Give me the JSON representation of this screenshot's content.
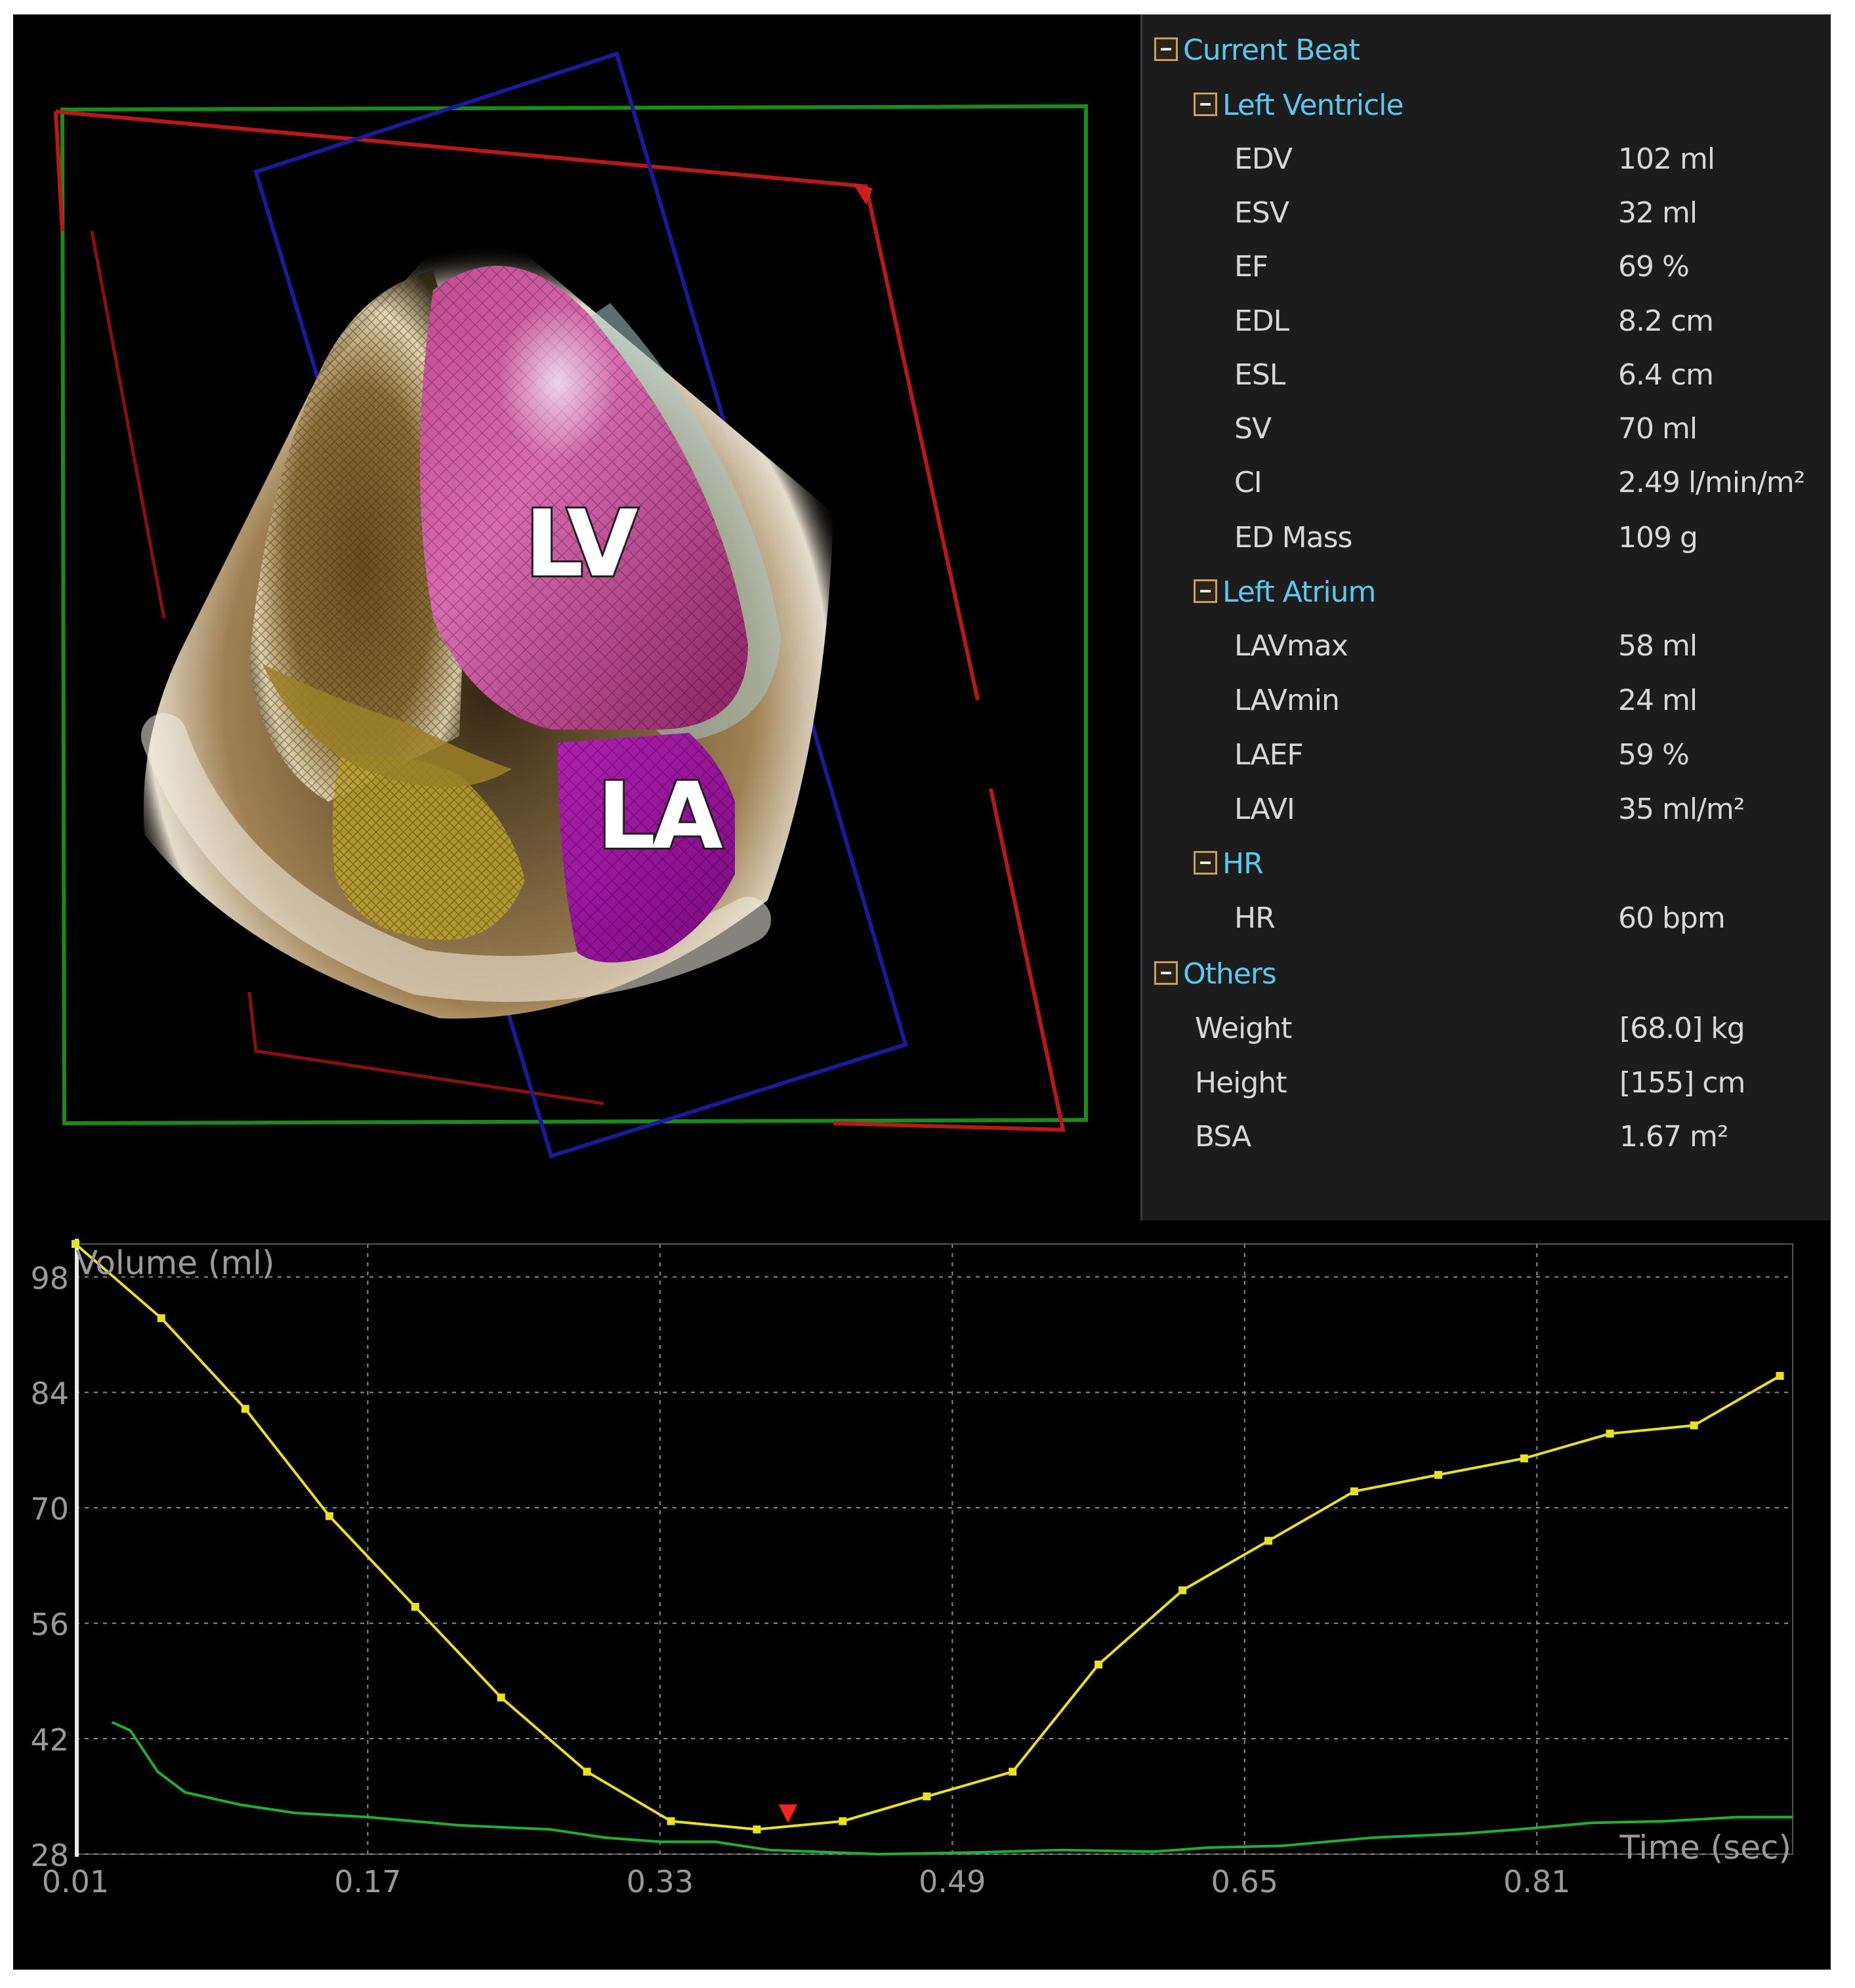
{
  "viewport": {
    "labels": {
      "lv": "LV",
      "la": "LA"
    }
  },
  "panel": {
    "sections": [
      {
        "title": "Current Beat",
        "groups": [
          {
            "title": "Left Ventricle",
            "rows": [
              {
                "label": "EDV",
                "value": "102 ml"
              },
              {
                "label": "ESV",
                "value": "32 ml"
              },
              {
                "label": "EF",
                "value": "69 %"
              },
              {
                "label": "EDL",
                "value": "8.2 cm"
              },
              {
                "label": "ESL",
                "value": "6.4 cm"
              },
              {
                "label": "SV",
                "value": "70 ml"
              },
              {
                "label": "CI",
                "value": "2.49 l/min/m²"
              },
              {
                "label": "ED Mass",
                "value": "109 g"
              }
            ]
          },
          {
            "title": "Left Atrium",
            "rows": [
              {
                "label": "LAVmax",
                "value": "58 ml"
              },
              {
                "label": "LAVmin",
                "value": "24 ml"
              },
              {
                "label": "LAEF",
                "value": "59 %"
              },
              {
                "label": "LAVI",
                "value": "35 ml/m²"
              }
            ]
          },
          {
            "title": "HR",
            "rows": [
              {
                "label": "HR",
                "value": "60 bpm"
              }
            ]
          }
        ]
      },
      {
        "title": "Others",
        "rows": [
          {
            "label": "Weight",
            "value": "[68.0] kg"
          },
          {
            "label": "Height",
            "value": "[155] cm"
          },
          {
            "label": "BSA",
            "value": "1.67 m²"
          }
        ]
      }
    ]
  },
  "chart_data": {
    "type": "line",
    "ylabel": "Volume (ml)",
    "xlabel": "Time (sec)",
    "x_ticks": [
      "0.01",
      "0.17",
      "0.33",
      "0.49",
      "0.65",
      "0.81"
    ],
    "y_ticks": [
      "98",
      "84",
      "70",
      "56",
      "42",
      "28"
    ],
    "xlim": [
      0.01,
      0.95
    ],
    "ylim": [
      28,
      102
    ],
    "colors": {
      "lv": "#e8e020",
      "la": "#20b030",
      "marker": "#ff2020",
      "grid": "#8a8a8a",
      "axis_text": "#9a9a9a"
    },
    "series": [
      {
        "values": [
          [
            0.01,
            102
          ],
          [
            0.057,
            93
          ],
          [
            0.103,
            82
          ],
          [
            0.149,
            69
          ],
          [
            0.196,
            58
          ],
          [
            0.243,
            47
          ],
          [
            0.29,
            38
          ],
          [
            0.336,
            32
          ],
          [
            0.383,
            31
          ],
          [
            0.43,
            32
          ],
          [
            0.476,
            35
          ],
          [
            0.523,
            38
          ],
          [
            0.57,
            51
          ],
          [
            0.616,
            60
          ],
          [
            0.663,
            66
          ],
          [
            0.71,
            72
          ],
          [
            0.756,
            74
          ],
          [
            0.803,
            76
          ],
          [
            0.85,
            79
          ],
          [
            0.896,
            80
          ],
          [
            0.943,
            86
          ]
        ],
        "markers": true
      },
      {
        "values": [
          [
            0.03,
            44
          ],
          [
            0.04,
            43
          ],
          [
            0.055,
            38
          ],
          [
            0.07,
            35.5
          ],
          [
            0.1,
            34
          ],
          [
            0.13,
            33
          ],
          [
            0.17,
            32.5
          ],
          [
            0.22,
            31.5
          ],
          [
            0.27,
            31
          ],
          [
            0.3,
            30
          ],
          [
            0.33,
            29.5
          ],
          [
            0.36,
            29.5
          ],
          [
            0.39,
            28.5
          ],
          [
            0.45,
            28
          ],
          [
            0.5,
            28.2
          ],
          [
            0.55,
            28.5
          ],
          [
            0.6,
            28.3
          ],
          [
            0.63,
            28.8
          ],
          [
            0.67,
            29
          ],
          [
            0.72,
            30
          ],
          [
            0.77,
            30.5
          ],
          [
            0.8,
            31
          ],
          [
            0.84,
            31.8
          ],
          [
            0.88,
            32
          ],
          [
            0.92,
            32.5
          ],
          [
            0.95,
            32.5
          ]
        ],
        "markers": false
      }
    ],
    "current_time_marker": 0.4
  }
}
